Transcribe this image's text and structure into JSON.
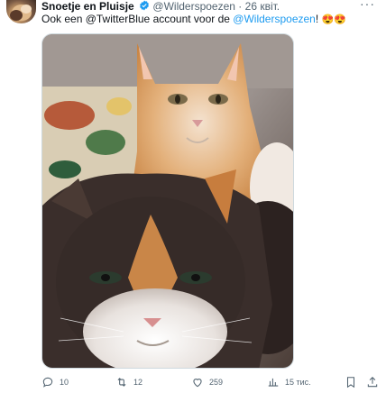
{
  "tweet": {
    "author_name": "Snoetje en Pluisje",
    "author_handle": "@Wilderspoezen",
    "separator": "·",
    "date": "26 квіт.",
    "more": "···",
    "text_prefix": "Ook een @TwitterBlue account voor de ",
    "text_link": "@Wilderspoezen",
    "text_suffix": "!",
    "emojis": "😍😍"
  },
  "actions": {
    "replies": "10",
    "retweets": "12",
    "likes": "259",
    "views": "15 тис."
  },
  "colors": {
    "link": "#1d9bf0",
    "verified": "#1d9bf0",
    "muted": "#536471"
  },
  "media": {
    "icon": "photo of two cats"
  }
}
